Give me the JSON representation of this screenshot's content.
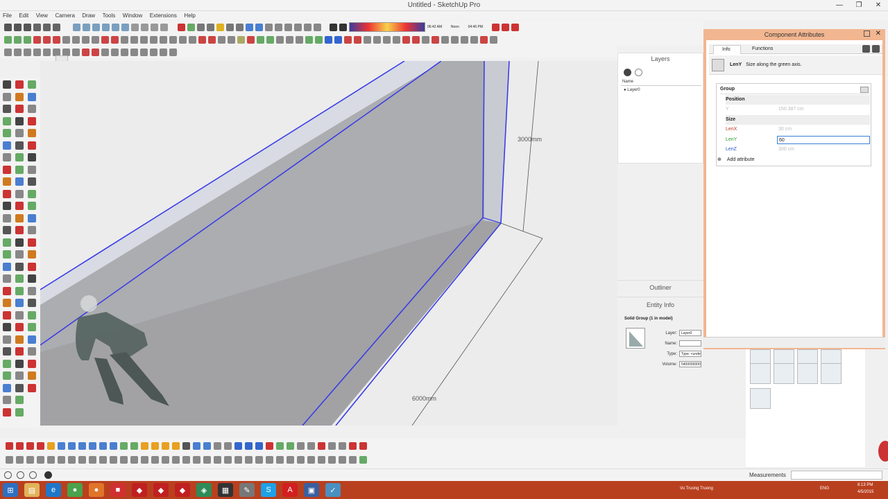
{
  "app": {
    "title": "Untitled - SketchUp Pro",
    "window_buttons": [
      "—",
      "❐",
      "✕"
    ]
  },
  "menu": [
    "File",
    "Edit",
    "View",
    "Camera",
    "Draw",
    "Tools",
    "Window",
    "Extensions",
    "Help"
  ],
  "shadow_bar": {
    "time_left": "06:42 AM",
    "time_mid": "Noon",
    "time_right": "04:46 PM"
  },
  "viewport": {
    "dimension_height": "3000mm",
    "dimension_length": "6000mm"
  },
  "layers_panel": {
    "title": "Layers",
    "column_name": "Name",
    "layer_name": "Layer0"
  },
  "outliner": {
    "title": "Outliner"
  },
  "entity_info": {
    "title": "Entity Info",
    "heading": "Solid Group (1 in model)",
    "layer_label": "Layer:",
    "layer_value": "Layer0",
    "name_label": "Name:",
    "name_value": "",
    "type_label": "Type:",
    "type_value": "Type: <undefined>",
    "volume_label": "Volume:",
    "volume_value": "5400000000 mm³"
  },
  "component_attributes": {
    "title": "Component Attributes",
    "tabs": [
      "Info",
      "Functions"
    ],
    "info_name": "LenY",
    "info_desc": "Size along the green axis.",
    "group_label": "Group",
    "section_position": "Position",
    "row_y_label": "Y",
    "row_y_value": "150.387 cm",
    "section_size": "Size",
    "lenx_label": "LenX",
    "lenx_value": "30 cm",
    "leny_label": "LenY",
    "leny_value": "60",
    "lenz_label": "LenZ",
    "lenz_value": "300 cm",
    "add_attribute": "Add attribute"
  },
  "status": {
    "measurements_label": "Measurements"
  },
  "taskbar": {
    "user": "Vu Truong Truong",
    "lang": "ENG",
    "time": "8:13 PM",
    "date": "4/5/2015"
  },
  "colors": {
    "accent_window": "#f2b690",
    "taskbar": "#b9401f",
    "edge_blue": "#3b3ee6",
    "wall_grey": "#a9a9ab"
  }
}
